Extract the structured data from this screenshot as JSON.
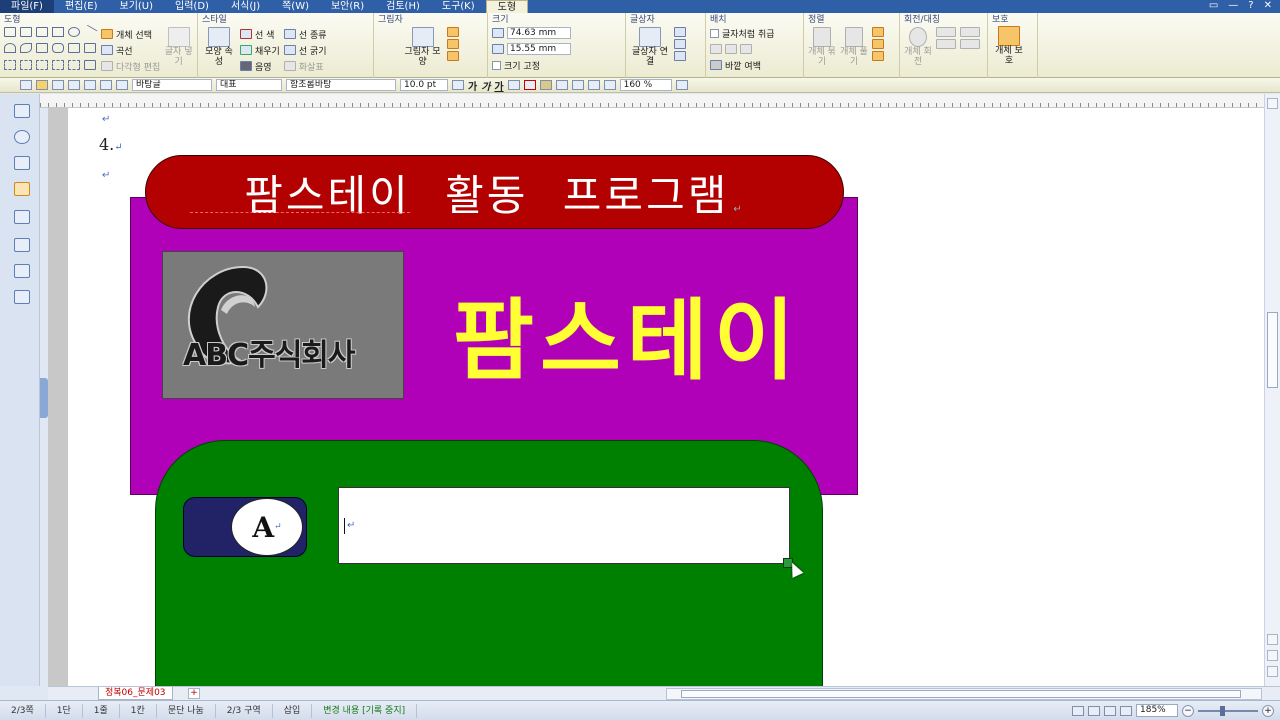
{
  "menus": [
    "파일(F)",
    "편집(E)",
    "보기(U)",
    "입력(D)",
    "서식(J)",
    "쪽(W)",
    "보안(R)",
    "검토(H)",
    "도구(K)",
    "도형"
  ],
  "ribbon": {
    "groups": {
      "shape": "도형",
      "style": "스타일",
      "shadow": "그림자",
      "size": "크기",
      "textbox": "글상자",
      "arrange": "배치",
      "align": "정렬",
      "rotate": "회전/대칭",
      "protect": "보호"
    },
    "shape_buttons": {
      "select": "개체 선택",
      "curve": "곡선",
      "polygon": "다각형 편집"
    },
    "text_wrap": "글자 넣기",
    "style_buttons": {
      "shape_props": "모양 속성",
      "line_color": "선 색",
      "fill": "채우기",
      "shadow": "음영",
      "line_type": "선 종류",
      "line_width": "선 굵기",
      "arrow": "화살표"
    },
    "shadow_btn": "그림자 모양",
    "size": {
      "width": "74.63",
      "height": "15.55",
      "unit": "mm",
      "fixed": "크기 고정"
    },
    "textbox_link": "글상자 연결",
    "arrange": {
      "treat_as_char": "글자처럼 취급",
      "outer_margin": "바깥 여백"
    },
    "align_btns": [
      "개체 묶기",
      "개체 풀기"
    ],
    "rotate_btns": [
      "개체 회전"
    ],
    "protect_btn": "개체 보호"
  },
  "toolbar2": {
    "style": "바탕글",
    "lang": "대표",
    "font": "함초롬바탕",
    "size": "10.0",
    "size_unit": "pt",
    "bold": "가",
    "italic": "가",
    "underline": "가",
    "zoom_percent": "160",
    "pct": "%"
  },
  "document": {
    "item_number": "4.",
    "para_mark": "↵",
    "title": "팜스테이 활동 프로그램",
    "logo_text": "ABC주식회사",
    "big_title": "팜스테이",
    "label_a": "A"
  },
  "bottom": {
    "doc_tab": "정복06_문제03",
    "tab_add": "+"
  },
  "status": {
    "page": "2/3쪽",
    "column": "1단",
    "line": "1줄",
    "col": "1칸",
    "section_para": "문단 나눔",
    "section": "2/3 구역",
    "insert": "삽입",
    "track": "변경 내용 [기록 중지]",
    "zoom": "185%"
  },
  "colors": {
    "title_pill": "#b30000",
    "purple": "#b000b8",
    "green": "#008000",
    "big_title": "#ffff33",
    "tag": "#222266"
  }
}
